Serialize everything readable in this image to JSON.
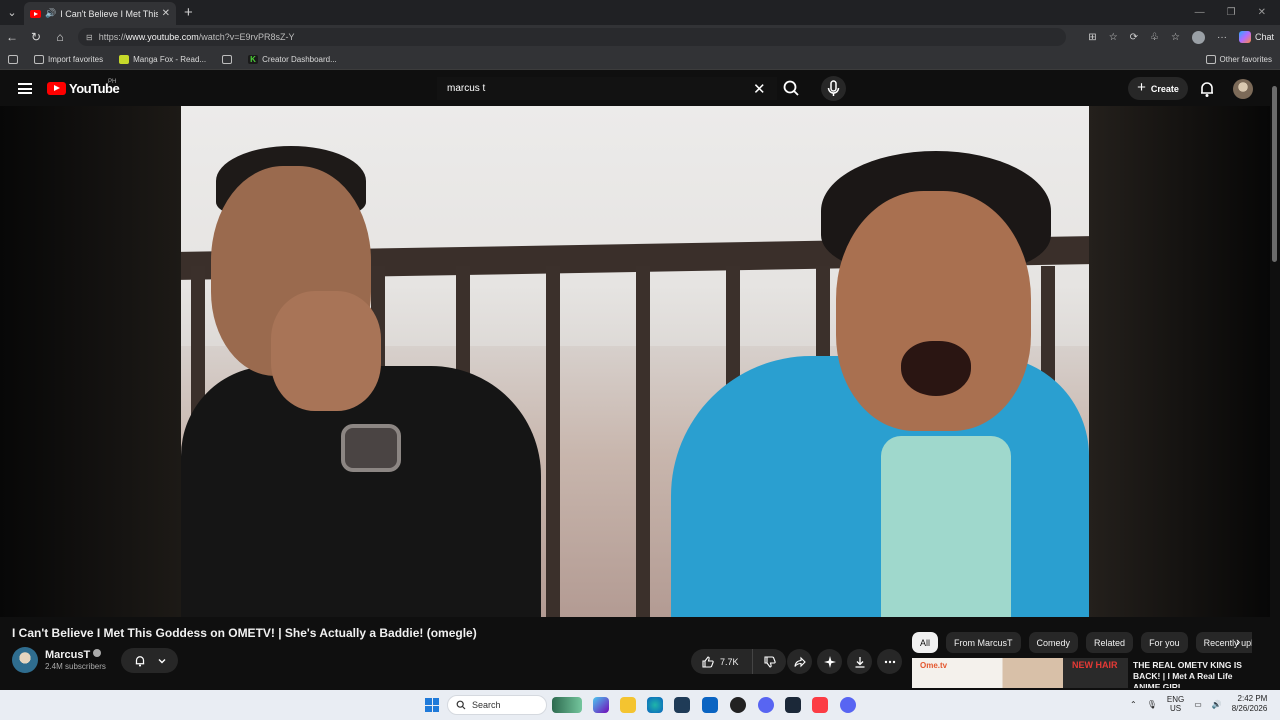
{
  "browser": {
    "tab_title": "I Can't Believe I Met This Goddess on OMETV! | She's Actually a Baddie! (omegle)",
    "url_prefix": "https://",
    "url_host": "www.youtube.com",
    "url_path": "/watch?v=E9rvPR8sZ-Y",
    "chat_label": "Chat",
    "favorites": [
      "Import favorites",
      "Manga Fox - Read...",
      "Creator Dashboard..."
    ],
    "other_favorites": "Other favorites"
  },
  "youtube": {
    "logo_text": "YouTube",
    "region": "PH",
    "search_value": "marcus t",
    "create_label": "Create"
  },
  "video": {
    "title": "I Can't Believe I Met This Goddess on OMETV! | She's Actually a Baddie! (omegle)",
    "channel": "MarcusT",
    "subscribers": "2.4M subscribers",
    "likes": "7.7K"
  },
  "chips": [
    "All",
    "From MarcusT",
    "Comedy",
    "Related",
    "For you",
    "Recently uploaded"
  ],
  "recommendation": {
    "thumb_brand": "Ome.tv",
    "thumb_overlay": "NEW HAIR",
    "title": "THE REAL OMETV KING IS BACK! | I Met A Real Life ANIME GIRL..."
  },
  "taskbar": {
    "search_label": "Search",
    "lang_top": "ENG",
    "lang_bottom": "US",
    "time": "2:42 PM",
    "date": "8/26/2026"
  },
  "icons": [
    "search-icon",
    "mic-icon",
    "bell-icon",
    "like-icon",
    "dislike-icon",
    "share-icon",
    "sparkle-icon",
    "download-icon",
    "more-icon"
  ]
}
